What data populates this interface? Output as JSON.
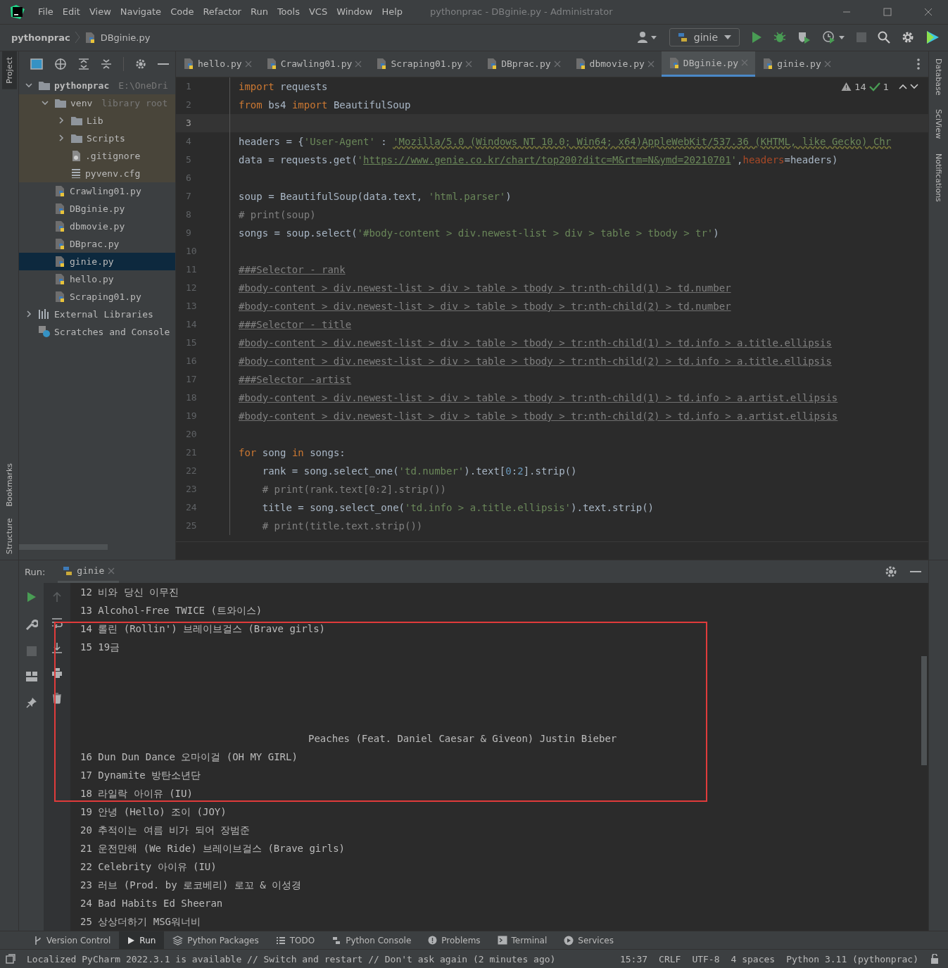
{
  "menu": [
    "File",
    "Edit",
    "View",
    "Navigate",
    "Code",
    "Refactor",
    "Run",
    "Tools",
    "VCS",
    "Window",
    "Help"
  ],
  "window": {
    "title": "pythonprac - DBginie.py - Administrator"
  },
  "breadcrumb": [
    "pythonprac",
    "DBginie.py"
  ],
  "run_config": "ginie",
  "left_stripe": {
    "top": [
      "Project"
    ],
    "bottom": [
      "Bookmarks",
      "Structure"
    ]
  },
  "right_stripe": [
    "Database",
    "SciView",
    "Notifications"
  ],
  "project_tree": [
    {
      "label": "pythonprac",
      "hint": "E:\\OneDri",
      "kind": "folder",
      "expanded": true,
      "selected": false,
      "children": [
        {
          "label": "venv",
          "hint": "library root",
          "kind": "folder",
          "expanded": true,
          "selected": false,
          "library_root": true,
          "children": [
            {
              "label": "Lib",
              "kind": "folder",
              "expanded": false,
              "selected": false
            },
            {
              "label": "Scripts",
              "kind": "folder",
              "expanded": false,
              "selected": false
            },
            {
              "label": ".gitignore",
              "kind": "ignore",
              "selected": false
            },
            {
              "label": "pyvenv.cfg",
              "kind": "cfg",
              "selected": false
            }
          ]
        },
        {
          "label": "Crawling01.py",
          "kind": "py",
          "selected": false
        },
        {
          "label": "DBginie.py",
          "kind": "py",
          "selected": false
        },
        {
          "label": "dbmovie.py",
          "kind": "py",
          "selected": false
        },
        {
          "label": "DBprac.py",
          "kind": "py",
          "selected": false
        },
        {
          "label": "ginie.py",
          "kind": "py",
          "selected": true
        },
        {
          "label": "hello.py",
          "kind": "py",
          "selected": false
        },
        {
          "label": "Scraping01.py",
          "kind": "py",
          "selected": false
        }
      ]
    },
    {
      "label": "External Libraries",
      "kind": "libs",
      "expanded": false,
      "selected": false
    },
    {
      "label": "Scratches and Console",
      "kind": "scratch",
      "selected": false
    }
  ],
  "tabs": [
    {
      "label": "hello.py",
      "selected": false
    },
    {
      "label": "Crawling01.py",
      "selected": false
    },
    {
      "label": "Scraping01.py",
      "selected": false
    },
    {
      "label": "DBprac.py",
      "selected": false
    },
    {
      "label": "dbmovie.py",
      "selected": false
    },
    {
      "label": "DBginie.py",
      "selected": true
    },
    {
      "label": "ginie.py",
      "selected": false
    }
  ],
  "inspections": {
    "warnings": "14",
    "ok": "1"
  },
  "code": [
    {
      "n": "1",
      "tokens": [
        {
          "text": "import",
          "kind": "kw"
        },
        {
          "text": " requests",
          "kind": "plain"
        }
      ]
    },
    {
      "n": "2",
      "tokens": [
        {
          "text": "from",
          "kind": "kw"
        },
        {
          "text": " bs4 ",
          "kind": "plain"
        },
        {
          "text": "import",
          "kind": "kw"
        },
        {
          "text": " BeautifulSoup",
          "kind": "plain"
        }
      ]
    },
    {
      "n": "3",
      "current": true
    },
    {
      "n": "4",
      "tokens": [
        {
          "text": "headers = {",
          "kind": "plain"
        },
        {
          "text": "'User-Agent'",
          "kind": "str"
        },
        {
          "text": " : ",
          "kind": "plain"
        },
        {
          "text": "'Mozilla/5.0 (Windows NT 10.0; Win64; x64)AppleWebKit/537.36 (KHTML, like Gecko) Chr",
          "kind": "strwarn"
        }
      ]
    },
    {
      "n": "5",
      "tokens": [
        {
          "text": "data = requests.get(",
          "kind": "plain"
        },
        {
          "text": "'",
          "kind": "str"
        },
        {
          "text": "https://www.genie.co.kr/chart/top200?ditc=M&rtm=N&ymd=20210701",
          "kind": "link"
        },
        {
          "text": "'",
          "kind": "str"
        },
        {
          "text": ",",
          "kind": "plain"
        },
        {
          "text": "headers",
          "kind": "param"
        },
        {
          "text": "=headers)",
          "kind": "plain"
        }
      ]
    },
    {
      "n": "6"
    },
    {
      "n": "7",
      "tokens": [
        {
          "text": "soup = BeautifulSoup(data.text, ",
          "kind": "plain"
        },
        {
          "text": "'html.parser'",
          "kind": "str"
        },
        {
          "text": ")",
          "kind": "plain"
        }
      ]
    },
    {
      "n": "8",
      "tokens": [
        {
          "text": "# print(soup)",
          "kind": "comment"
        }
      ]
    },
    {
      "n": "9",
      "tokens": [
        {
          "text": "songs = soup.select(",
          "kind": "plain"
        },
        {
          "text": "'#body-content > div.newest-list > div > table > tbody > tr'",
          "kind": "str"
        },
        {
          "text": ")",
          "kind": "plain"
        }
      ]
    },
    {
      "n": "10"
    },
    {
      "n": "11",
      "tokens": [
        {
          "text": "###Selector - rank",
          "kind": "commentwarn"
        }
      ]
    },
    {
      "n": "12",
      "tokens": [
        {
          "text": "#body-content > div.newest-list > div > table > tbody > tr:nth-child(1) > td.number",
          "kind": "commentwarn"
        }
      ]
    },
    {
      "n": "13",
      "tokens": [
        {
          "text": "#body-content > div.newest-list > div > table > tbody > tr:nth-child(2) > td.number",
          "kind": "commentwarn"
        }
      ]
    },
    {
      "n": "14",
      "tokens": [
        {
          "text": "###Selector - title",
          "kind": "commentwarn"
        }
      ]
    },
    {
      "n": "15",
      "tokens": [
        {
          "text": "#body-content > div.newest-list > div > table > tbody > tr:nth-child(1) > td.info > a.title.ellipsis",
          "kind": "commentwarn"
        }
      ]
    },
    {
      "n": "16",
      "tokens": [
        {
          "text": "#body-content > div.newest-list > div > table > tbody > tr:nth-child(2) > td.info > a.title.ellipsis",
          "kind": "commentwarn"
        }
      ]
    },
    {
      "n": "17",
      "tokens": [
        {
          "text": "###Selector -artist",
          "kind": "commentwarn"
        }
      ]
    },
    {
      "n": "18",
      "tokens": [
        {
          "text": "#body-content > div.newest-list > div > table > tbody > tr:nth-child(1) > td.info > a.artist.ellipsis",
          "kind": "commentwarn"
        }
      ]
    },
    {
      "n": "19",
      "tokens": [
        {
          "text": "#body-content > div.newest-list > div > table > tbody > tr:nth-child(2) > td.info > a.artist.ellipsis",
          "kind": "commentwarn"
        }
      ]
    },
    {
      "n": "20"
    },
    {
      "n": "21",
      "tokens": [
        {
          "text": "for",
          "kind": "kw"
        },
        {
          "text": " song ",
          "kind": "plain"
        },
        {
          "text": "in",
          "kind": "kw"
        },
        {
          "text": " songs:",
          "kind": "plain"
        }
      ]
    },
    {
      "n": "22",
      "tokens": [
        {
          "text": "    rank = song.select_one(",
          "kind": "plain"
        },
        {
          "text": "'td.number'",
          "kind": "str"
        },
        {
          "text": ").text[",
          "kind": "plain"
        },
        {
          "text": "0",
          "kind": "num"
        },
        {
          "text": ":",
          "kind": "plain"
        },
        {
          "text": "2",
          "kind": "num"
        },
        {
          "text": "].strip()",
          "kind": "plain"
        }
      ]
    },
    {
      "n": "23",
      "tokens": [
        {
          "text": "    # print(rank.text[0:2].strip())",
          "kind": "comment"
        }
      ]
    },
    {
      "n": "24",
      "tokens": [
        {
          "text": "    title = song.select_one(",
          "kind": "plain"
        },
        {
          "text": "'td.info > a.title.ellipsis'",
          "kind": "str"
        },
        {
          "text": ").text.strip()",
          "kind": "plain"
        }
      ]
    },
    {
      "n": "25",
      "tokens": [
        {
          "text": "    # print(title.text.strip())",
          "kind": "comment"
        }
      ]
    }
  ],
  "run": {
    "label": "Run:",
    "tab": "ginie",
    "output": [
      {
        "text": "12 비와 당신 이무진",
        "kind": "line"
      },
      {
        "text": "13 Alcohol-Free TWICE (트와이스)",
        "kind": "line"
      },
      {
        "text": "14 롤린 (Rollin') 브레이브걸스 (Brave girls)",
        "kind": "line"
      },
      {
        "text": "15 19금",
        "kind": "line"
      },
      {
        "text": "Peaches (Feat. Daniel Caesar & Giveon) Justin Bieber",
        "kind": "spaced"
      },
      {
        "text": "16 Dun Dun Dance 오마이걸 (OH MY GIRL)",
        "kind": "line"
      },
      {
        "text": "17 Dynamite 방탄소년단",
        "kind": "line"
      },
      {
        "text": "18 라일락 아이유 (IU)",
        "kind": "line"
      },
      {
        "text": "19 안녕 (Hello) 조이 (JOY)",
        "kind": "line"
      },
      {
        "text": "20 추적이는 여름 비가 되어 장범준",
        "kind": "line"
      },
      {
        "text": "21 운전만해 (We Ride) 브레이브걸스 (Brave girls)",
        "kind": "line"
      },
      {
        "text": "22 Celebrity 아이유 (IU)",
        "kind": "line"
      },
      {
        "text": "23 러브 (Prod. by 로코베리) 로꼬 & 이성경",
        "kind": "line"
      },
      {
        "text": "24 Bad Habits Ed Sheeran",
        "kind": "line"
      },
      {
        "text": "25 상상더하기 MSG워너비",
        "kind": "line"
      }
    ]
  },
  "tool_tabs": [
    {
      "label": "Version Control",
      "kind": "vcs",
      "selected": false
    },
    {
      "label": "Run",
      "kind": "run",
      "selected": true
    },
    {
      "label": "Python Packages",
      "kind": "packages",
      "selected": false
    },
    {
      "label": "TODO",
      "kind": "todo",
      "selected": false
    },
    {
      "label": "Python Console",
      "kind": "python",
      "selected": false
    },
    {
      "label": "Problems",
      "kind": "problems",
      "selected": false
    },
    {
      "label": "Terminal",
      "kind": "terminal",
      "selected": false
    },
    {
      "label": "Services",
      "kind": "services",
      "selected": false
    }
  ],
  "status_bar": {
    "message": "Localized PyCharm 2022.3.1 is available // Switch and restart // Don't ask again (2 minutes ago)",
    "items": [
      "15:37",
      "CRLF",
      "UTF-8",
      "4 spaces",
      "Python 3.11 (pythonprac)"
    ]
  }
}
